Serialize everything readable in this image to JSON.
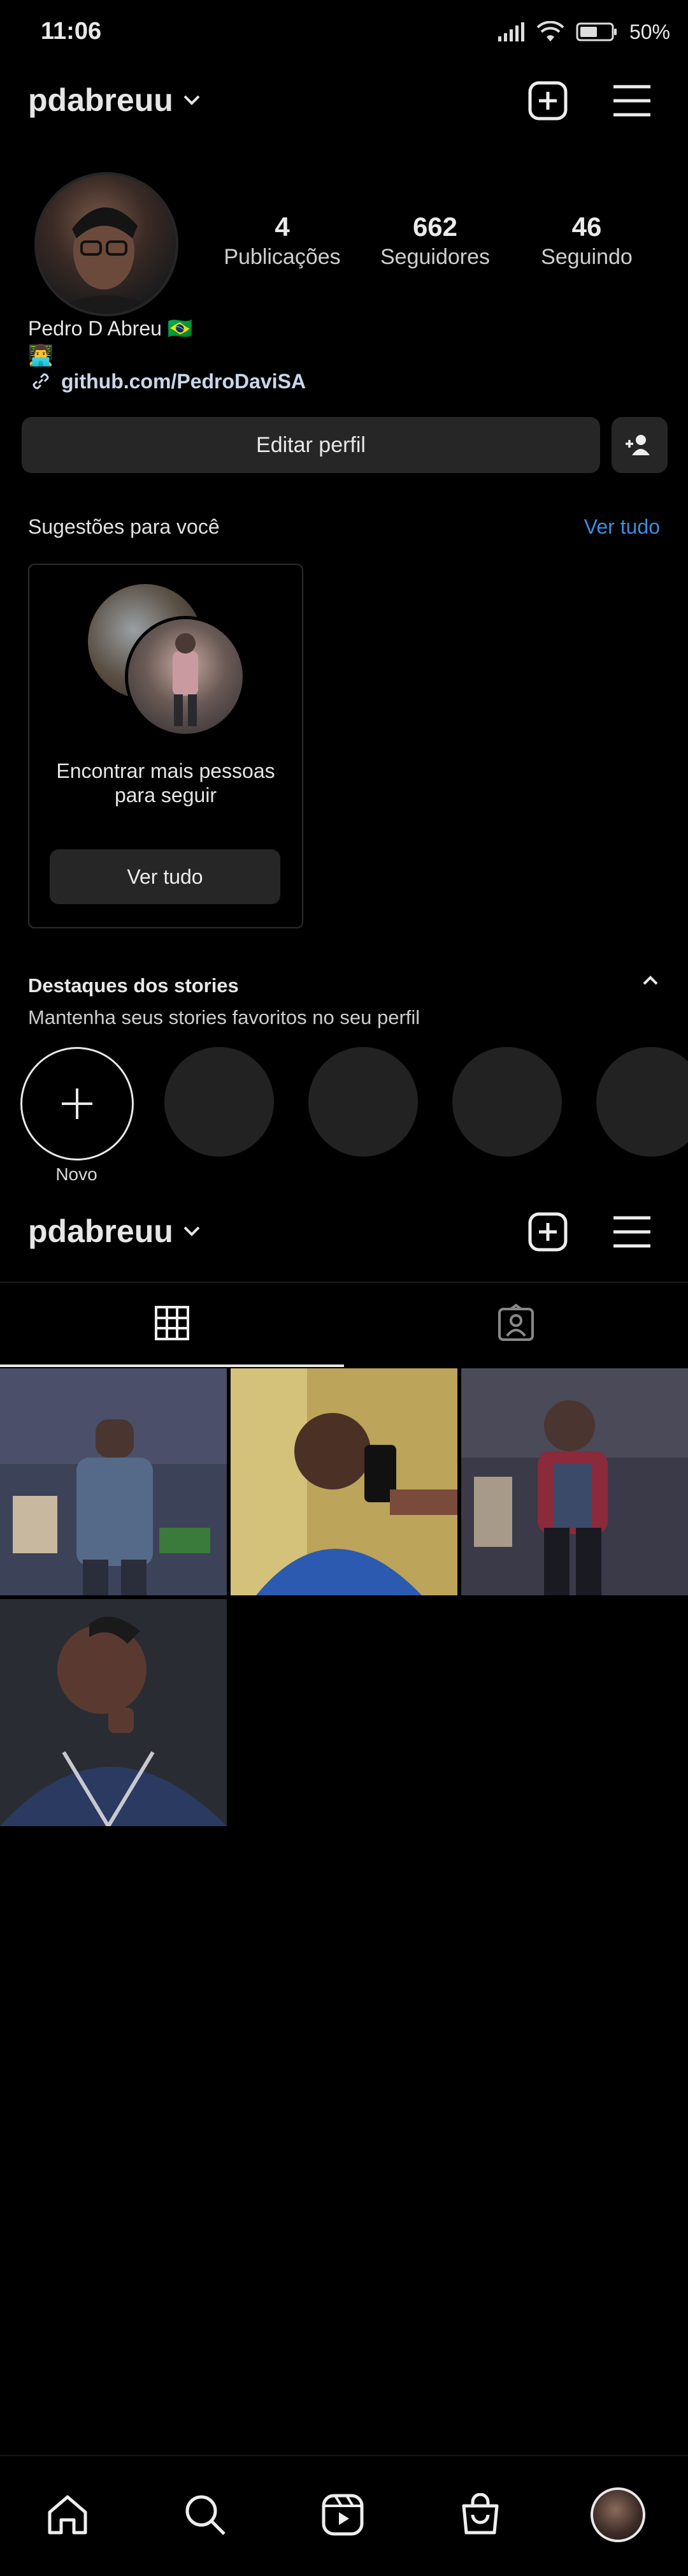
{
  "status_bar": {
    "time": "11:06",
    "battery": "50%"
  },
  "header": {
    "username": "pdabreuu",
    "icons": [
      "chevron-down-icon",
      "plus-square-icon",
      "menu-icon"
    ]
  },
  "profile": {
    "stats": [
      {
        "value": "4",
        "label": "Publicações"
      },
      {
        "value": "662",
        "label": "Seguidores"
      },
      {
        "value": "46",
        "label": "Seguindo"
      }
    ],
    "name": "Pedro D Abreu 🇧🇷",
    "emoji": "👨‍💻",
    "link": "github.com/PedroDaviSA",
    "edit_label": "Editar perfil"
  },
  "suggestions": {
    "title": "Sugestões para você",
    "see_all": "Ver tudo",
    "card_text": "Encontrar mais pessoas para seguir",
    "card_button": "Ver tudo"
  },
  "highlights": {
    "title": "Destaques dos stories",
    "subtitle": "Mantenha seus stories favoritos no seu perfil",
    "new_label": "Novo"
  },
  "sticky_header": {
    "username": "pdabreuu"
  },
  "tabs": [
    {
      "name": "grid",
      "icon": "grid-icon",
      "active": true
    },
    {
      "name": "tagged",
      "icon": "tagged-icon",
      "active": false
    }
  ],
  "posts": [
    {
      "icon": "photo-1",
      "accent": "#3a4a6a"
    },
    {
      "icon": "photo-2",
      "accent": "#c9b86a"
    },
    {
      "icon": "photo-3",
      "accent": "#6a3a40"
    },
    {
      "icon": "photo-4",
      "accent": "#2a3550"
    }
  ],
  "nav": [
    "home-icon",
    "search-icon",
    "reels-icon",
    "shop-icon",
    "profile-avatar"
  ]
}
